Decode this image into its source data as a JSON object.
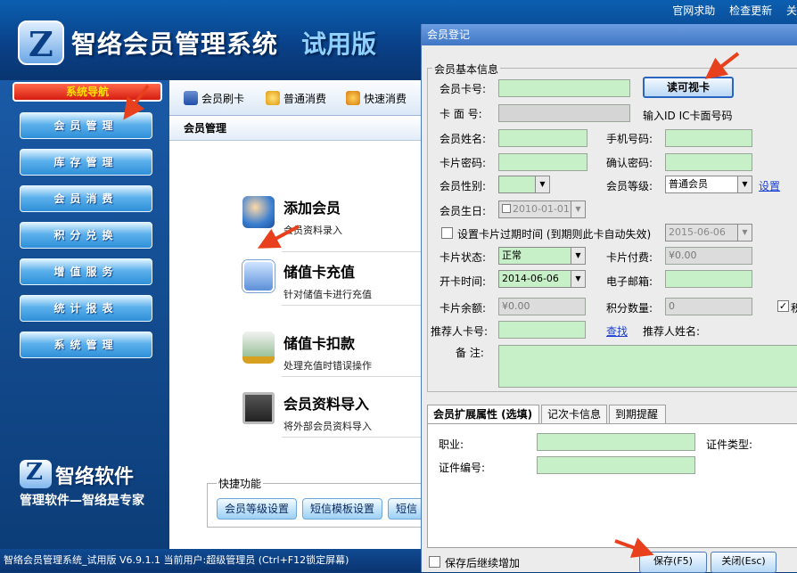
{
  "header": {
    "app_title": "智络会员管理系统",
    "edition": "试用版",
    "logo_letter": "Z",
    "top_links": [
      "官网求助",
      "检查更新",
      "关"
    ]
  },
  "sidebar": {
    "nav_title": "系统导航",
    "items": [
      "会员管理",
      "库存管理",
      "会员消费",
      "积分兑换",
      "增值服务",
      "统计报表",
      "系统管理"
    ],
    "brand_name": "智络软件",
    "brand_slogan": "管理软件—智络是专家"
  },
  "toolbar": {
    "items": [
      "会员刷卡",
      "普通消费",
      "快速消费"
    ]
  },
  "main": {
    "title": "会员管理",
    "features": [
      {
        "title": "添加会员",
        "desc": "会员资料录入"
      },
      {
        "title": "储值卡充值",
        "desc": "针对储值卡进行充值"
      },
      {
        "title": "储值卡扣款",
        "desc": "处理充值时错误操作"
      },
      {
        "title": "会员资料导入",
        "desc": "将外部会员资料导入"
      }
    ],
    "quick_label": "快捷功能",
    "quick_buttons": [
      "会员等级设置",
      "短信模板设置",
      "短信"
    ]
  },
  "statusbar": {
    "text": "智络会员管理系统_试用版 V6.9.1.1 当前用户:超级管理员 (Ctrl+F12锁定屏幕)"
  },
  "dialog": {
    "title": "会员登记",
    "basic_legend": "会员基本信息",
    "labels": {
      "card_no": "会员卡号:",
      "card_face_no": "卡 面 号:",
      "name": "会员姓名:",
      "phone": "手机号码:",
      "card_password": "卡片密码:",
      "confirm_password": "确认密码:",
      "gender": "会员性别:",
      "level": "会员等级:",
      "birthday": "会员生日:",
      "expire_check": "设置卡片过期时间 (到期则此卡自动失效)",
      "card_status": "卡片状态:",
      "card_fee": "卡片付费:",
      "open_date": "开卡时间:",
      "email": "电子邮箱:",
      "balance": "卡片余额:",
      "points": "积分数量:",
      "referrer_card": "推荐人卡号:",
      "referrer_name": "推荐人姓名:",
      "remark": "备 注:"
    },
    "read_card_button": "读可视卡",
    "card_face_hint": "输入ID IC卡面号码",
    "level_value": "普通会员",
    "level_setting_link": "设置",
    "birthday_value": "2010-01-01",
    "expire_date_value": "2015-06-06",
    "card_status_value": "正常",
    "card_fee_value": "¥0.00",
    "open_date_value": "2014-06-06",
    "balance_value": "¥0.00",
    "points_value": "0",
    "points_side_label": "积",
    "referrer_lookup_link": "查找",
    "tabs": [
      "会员扩展属性 (选填)",
      "记次卡信息",
      "到期提醒"
    ],
    "ext_labels": {
      "occupation": "职业:",
      "id_type": "证件类型:",
      "id_number": "证件编号:"
    },
    "continue_add_label": "保存后继续增加",
    "save_button": "保存(F5)",
    "close_button": "关闭(Esc)"
  },
  "colors": {
    "header_blue": "#0a3f86",
    "input_green": "#c8f0c8",
    "nav_title_red": "#d61c10",
    "nav_title_text": "#ffe200",
    "annotation_arrow": "#e8401c",
    "dialog_bg": "#ececec"
  }
}
